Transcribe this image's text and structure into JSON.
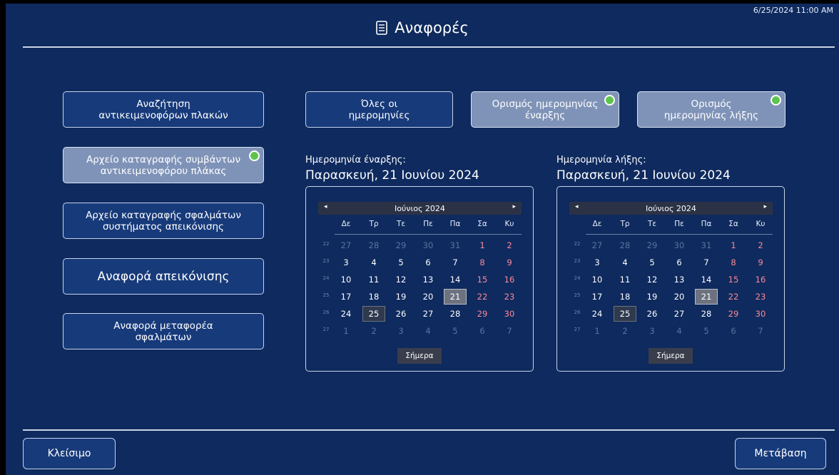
{
  "header": {
    "datetime": "6/25/2024 11:00 AM",
    "title": "Αναφορές",
    "title_icon": "report-document-icon"
  },
  "sidebar": {
    "items": [
      {
        "label": "Αναζήτηση\nαντικειμενοφόρων πλακών",
        "selected": false
      },
      {
        "label": "Αρχείο καταγραφής συμβάντων\nαντικειμενοφόρου πλάκας",
        "selected": true
      },
      {
        "label": "Αρχείο καταγραφής σφαλμάτων\nσυστήματος απεικόνισης",
        "selected": false
      },
      {
        "label": "Αναφορά απεικόνισης",
        "selected": false
      },
      {
        "label": "Αναφορά μεταφορέα\nσφαλμάτων",
        "selected": false
      }
    ]
  },
  "date_options": {
    "items": [
      {
        "label": "Όλες οι\nημερομηνίες",
        "selected": false
      },
      {
        "label": "Ορισμός ημερομηνίας\nέναρξης",
        "selected": true
      },
      {
        "label": "Ορισμός\nημερομηνίας λήξης",
        "selected": true
      }
    ]
  },
  "calendars": {
    "start": {
      "label": "Ημερομηνία έναρξης:",
      "date": "Παρασκευή, 21 Ιουνίου 2024",
      "month": "Ιούνιος 2024",
      "today_label": "Σήμερα"
    },
    "end": {
      "label": "Ημερομηνία λήξης:",
      "date": "Παρασκευή, 21 Ιουνίου 2024",
      "month": "Ιούνιος 2024",
      "today_label": "Σήμερα"
    },
    "weekdays": [
      "Δε",
      "Τρ",
      "Τε",
      "Πε",
      "Πα",
      "Σα",
      "Κυ"
    ],
    "weeks": [
      {
        "week": "22",
        "days": [
          "27",
          "28",
          "29",
          "30",
          "31",
          "1",
          "2"
        ]
      },
      {
        "week": "23",
        "days": [
          "3",
          "4",
          "5",
          "6",
          "7",
          "8",
          "9"
        ]
      },
      {
        "week": "24",
        "days": [
          "10",
          "11",
          "12",
          "13",
          "14",
          "15",
          "16"
        ]
      },
      {
        "week": "25",
        "days": [
          "17",
          "18",
          "19",
          "20",
          "21",
          "22",
          "23"
        ]
      },
      {
        "week": "26",
        "days": [
          "24",
          "25",
          "26",
          "27",
          "28",
          "29",
          "30"
        ]
      },
      {
        "week": "27",
        "days": [
          "1",
          "2",
          "3",
          "4",
          "5",
          "6",
          "7"
        ]
      }
    ],
    "selected_day": "21",
    "today_day": "25"
  },
  "footer": {
    "close_label": "Κλείσιμο",
    "go_label": "Μετάβαση"
  },
  "colors": {
    "background": "#0e2a5e",
    "button": "#173a7a",
    "button_selected": "#7f93b8",
    "weekend": "#ff8a96",
    "check": "#5fc44e"
  }
}
